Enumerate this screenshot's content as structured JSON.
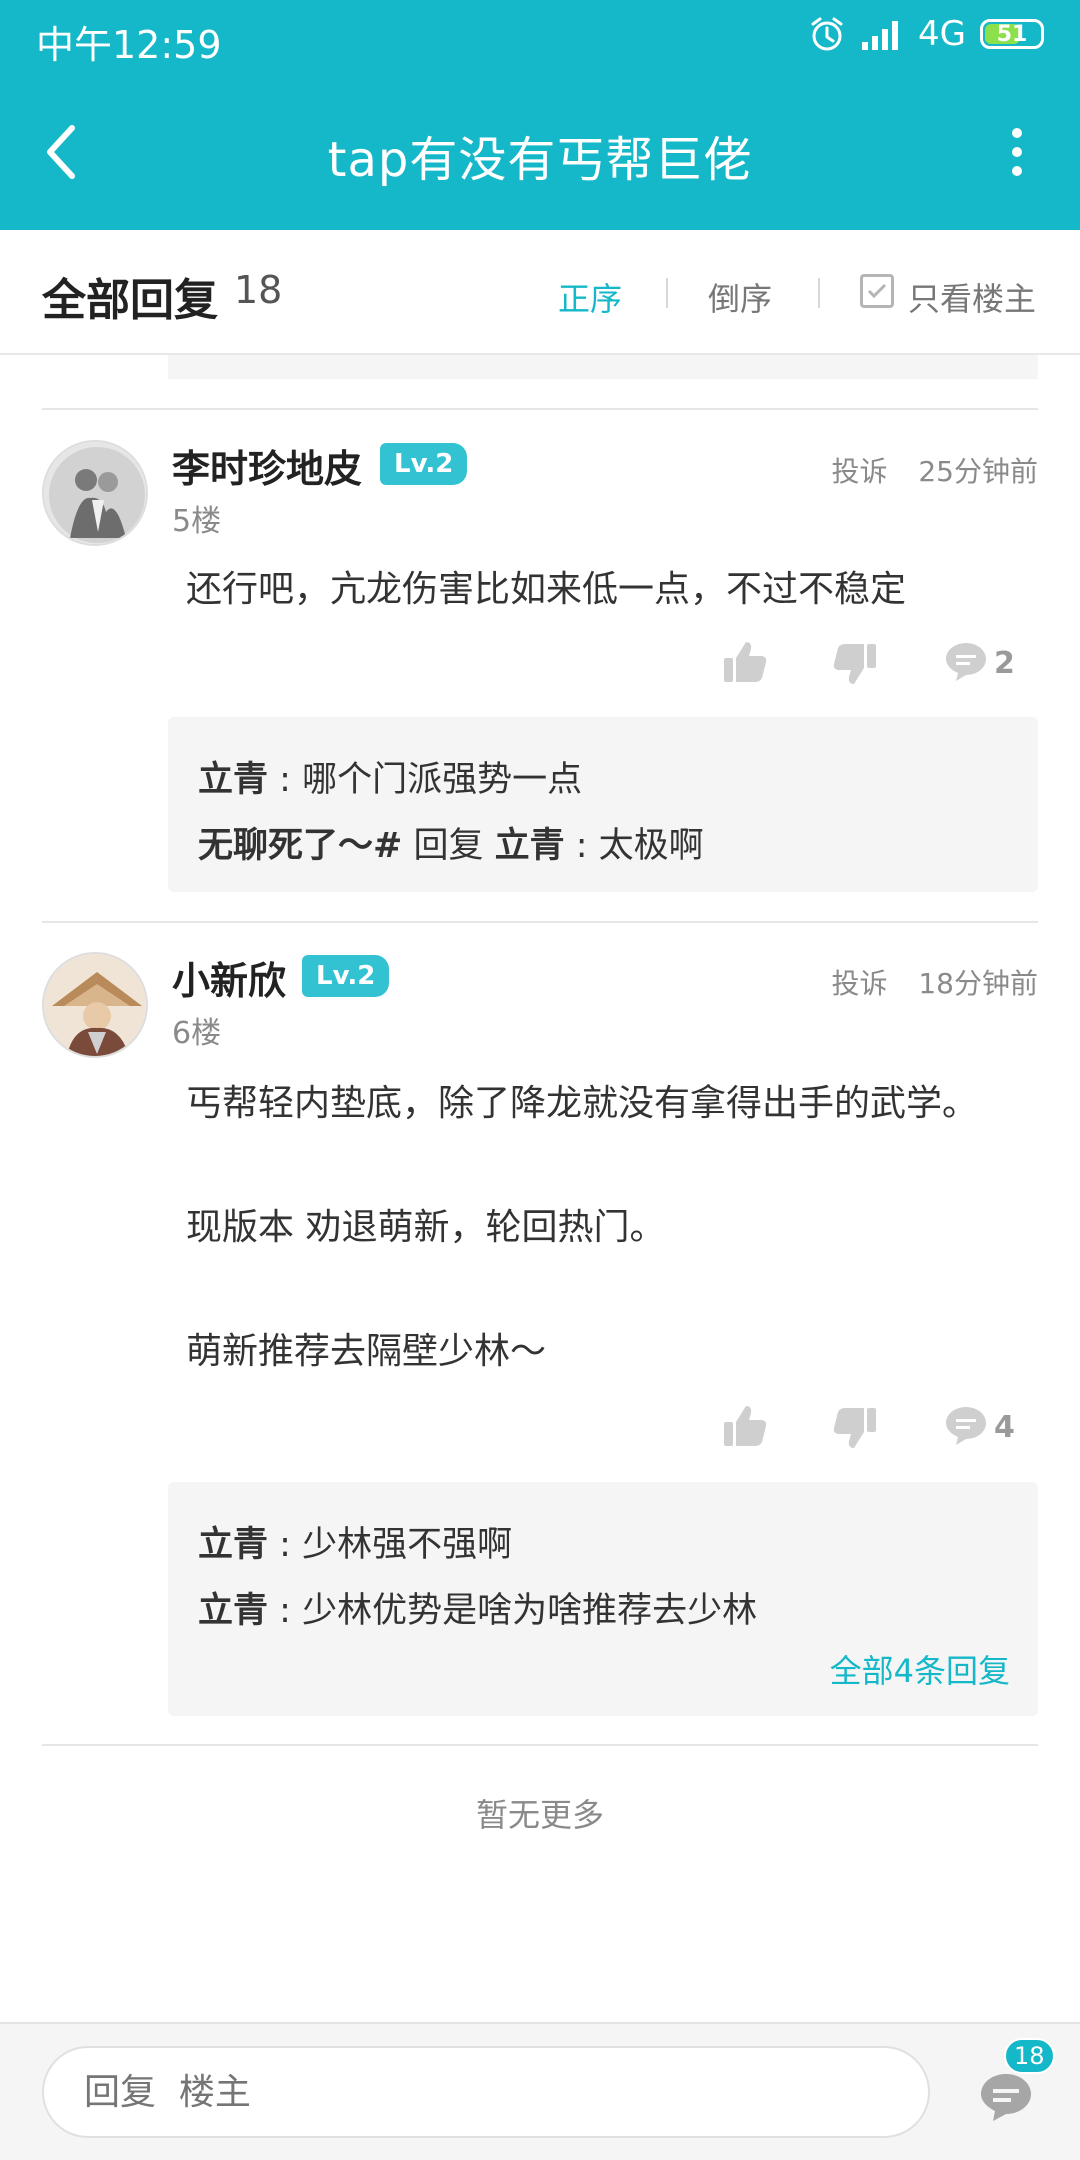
{
  "status_bar": {
    "time": "中午12:59",
    "network": "4G",
    "battery": "51"
  },
  "nav": {
    "title": "tap有没有丐帮巨佬"
  },
  "sort_bar": {
    "heading": "全部回复",
    "count": "18",
    "options": [
      "正序",
      "倒序"
    ],
    "active_option": "正序",
    "only_op_label": "只看楼主"
  },
  "posts": [
    {
      "username": "李时珍地皮",
      "level": "Lv.2",
      "floor": "5楼",
      "report_label": "投诉",
      "time": "25分钟前",
      "content_lines": [
        "还行吧，亢龙伤害比如来低一点，不过不稳定"
      ],
      "reply_count": "2",
      "sub_replies": [
        {
          "user": "立青",
          "sep": " : ",
          "text": "哪个门派强势一点"
        },
        {
          "user": "无聊死了～#",
          "mid": " 回复 ",
          "target": "立青",
          "sep": " : ",
          "text": "太极啊"
        }
      ]
    },
    {
      "username": "小新欣",
      "level": "Lv.2",
      "floor": "6楼",
      "report_label": "投诉",
      "time": "18分钟前",
      "content_lines": [
        "丐帮轻内垫底，除了降龙就没有拿得出手的武学。",
        "现版本 劝退萌新，轮回热门。",
        "萌新推荐去隔壁少林～"
      ],
      "reply_count": "4",
      "sub_replies": [
        {
          "user": "立青",
          "sep": " : ",
          "text": "少林强不强啊"
        },
        {
          "user": "立青",
          "sep": " : ",
          "text": "少林优势是啥为啥推荐去少林"
        }
      ],
      "see_all_label": "全部4条回复"
    }
  ],
  "footer_text": "暂无更多",
  "bottom_bar": {
    "input_placeholder": "回复  楼主",
    "comment_badge": "18"
  },
  "colors": {
    "accent": "#15b8c8",
    "level_badge": "#33c2d2"
  },
  "icons": [
    "back-arrow-icon",
    "more-vertical-icon",
    "alarm-icon",
    "signal-icon",
    "battery-icon",
    "checkbox-icon",
    "thumb-up-icon",
    "thumb-down-icon",
    "comment-icon"
  ]
}
